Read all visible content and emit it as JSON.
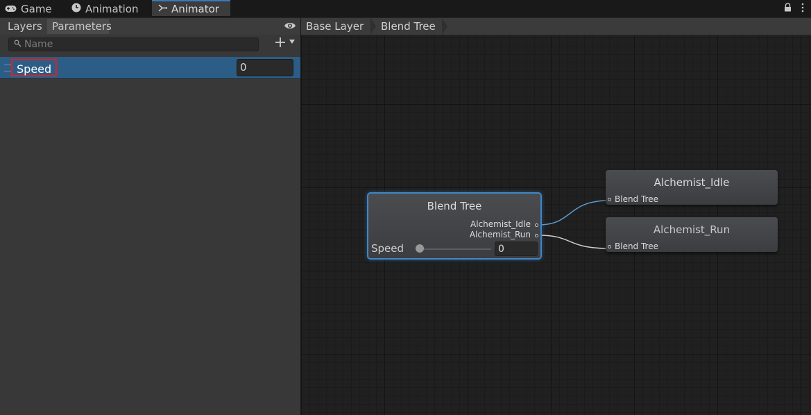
{
  "tabs": [
    {
      "label": "Game",
      "icon": "gamepad-icon"
    },
    {
      "label": "Animation",
      "icon": "clock-icon"
    },
    {
      "label": "Animator",
      "icon": "animator-icon",
      "active": true
    }
  ],
  "left_panel": {
    "subtabs": [
      "Layers",
      "Parameters"
    ],
    "selected_subtab": "Parameters",
    "search": {
      "placeholder": "Name",
      "value": ""
    },
    "parameters": [
      {
        "name": "Speed",
        "value": "0",
        "selected": true
      }
    ]
  },
  "graph": {
    "breadcrumbs": [
      "Base Layer",
      "Blend Tree"
    ],
    "blend_node": {
      "title": "Blend Tree",
      "outputs": [
        "Alchemist_Idle",
        "Alchemist_Run"
      ],
      "param_label": "Speed",
      "param_value": "0"
    },
    "clip_nodes": [
      {
        "title": "Alchemist_Idle",
        "input_label": "Blend Tree"
      },
      {
        "title": "Alchemist_Run",
        "input_label": "Blend Tree"
      }
    ]
  },
  "colors": {
    "accent": "#3a79bb",
    "selection": "#2c5d87",
    "highlight_box": "#e02020",
    "wire_active": "#5b9ad0",
    "wire": "#cfcfcf"
  }
}
